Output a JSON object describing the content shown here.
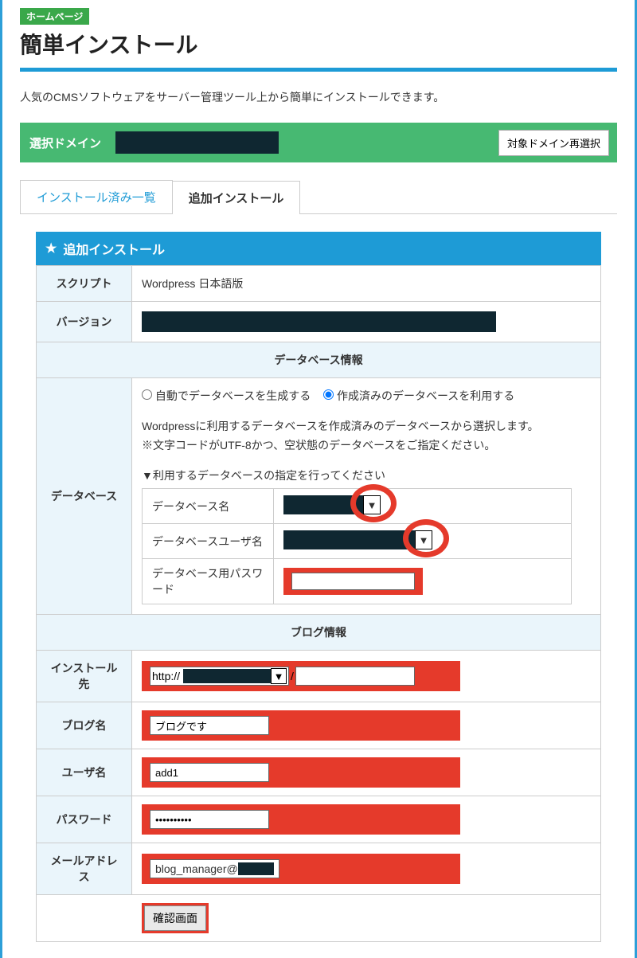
{
  "header": {
    "category": "ホームページ",
    "title": "簡単インストール",
    "intro": "人気のCMSソフトウェアをサーバー管理ツール上から簡単にインストールできます。"
  },
  "domain_bar": {
    "label": "選択ドメイン",
    "reselect_btn": "対象ドメイン再選択"
  },
  "tabs": {
    "installed": "インストール済み一覧",
    "add": "追加インストール"
  },
  "panel": {
    "title": "追加インストール"
  },
  "form": {
    "script": {
      "label": "スクリプト",
      "value": "Wordpress 日本語版"
    },
    "version": {
      "label": "バージョン"
    },
    "db_section": "データベース情報",
    "database": {
      "label": "データベース",
      "radio_auto": "自動でデータベースを生成する",
      "radio_existing": "作成済みのデータベースを利用する",
      "instruction": "Wordpressに利用するデータベースを作成済みのデータベースから選択します。",
      "note": "※文字コードがUTF-8かつ、空状態のデータベースをご指定ください。",
      "select_prompt": "▼利用するデータベースの指定を行ってください",
      "inner": {
        "db_name": "データベース名",
        "db_user": "データベースユーザ名",
        "db_password": "データベース用パスワード"
      }
    },
    "blog_section": "ブログ情報",
    "install_dest_label": "インストール先",
    "install_dest_prefix": "http://",
    "install_dest_sep": "/",
    "blog_name": {
      "label": "ブログ名",
      "value": "ブログです"
    },
    "username": {
      "label": "ユーザ名",
      "value": "add1"
    },
    "password": {
      "label": "パスワード",
      "value": "••••••••••"
    },
    "email": {
      "label": "メールアドレス",
      "value": "blog_manager@"
    },
    "confirm_btn": "確認画面"
  }
}
